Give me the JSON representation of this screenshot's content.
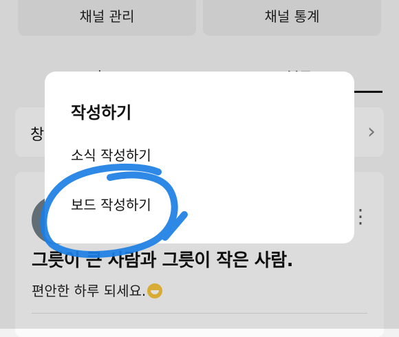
{
  "top_buttons": {
    "manage": "채널 관리",
    "stats": "채널 통계"
  },
  "tabs": {
    "home": "홈",
    "board": "보드"
  },
  "channel_row": {
    "label": "창",
    "chevron": "›"
  },
  "post": {
    "more": "⋮",
    "title": "그릇이 큰 사람과 그릇이 작은 사람.",
    "subtitle": "편안한 하루 되세요."
  },
  "modal": {
    "title": "작성하기",
    "items": [
      {
        "label": "소식 작성하기"
      },
      {
        "label": "보드 작성하기"
      }
    ]
  },
  "annotation": {
    "color": "#1b7fe3",
    "icon": "hand-drawn-circle-icon"
  }
}
